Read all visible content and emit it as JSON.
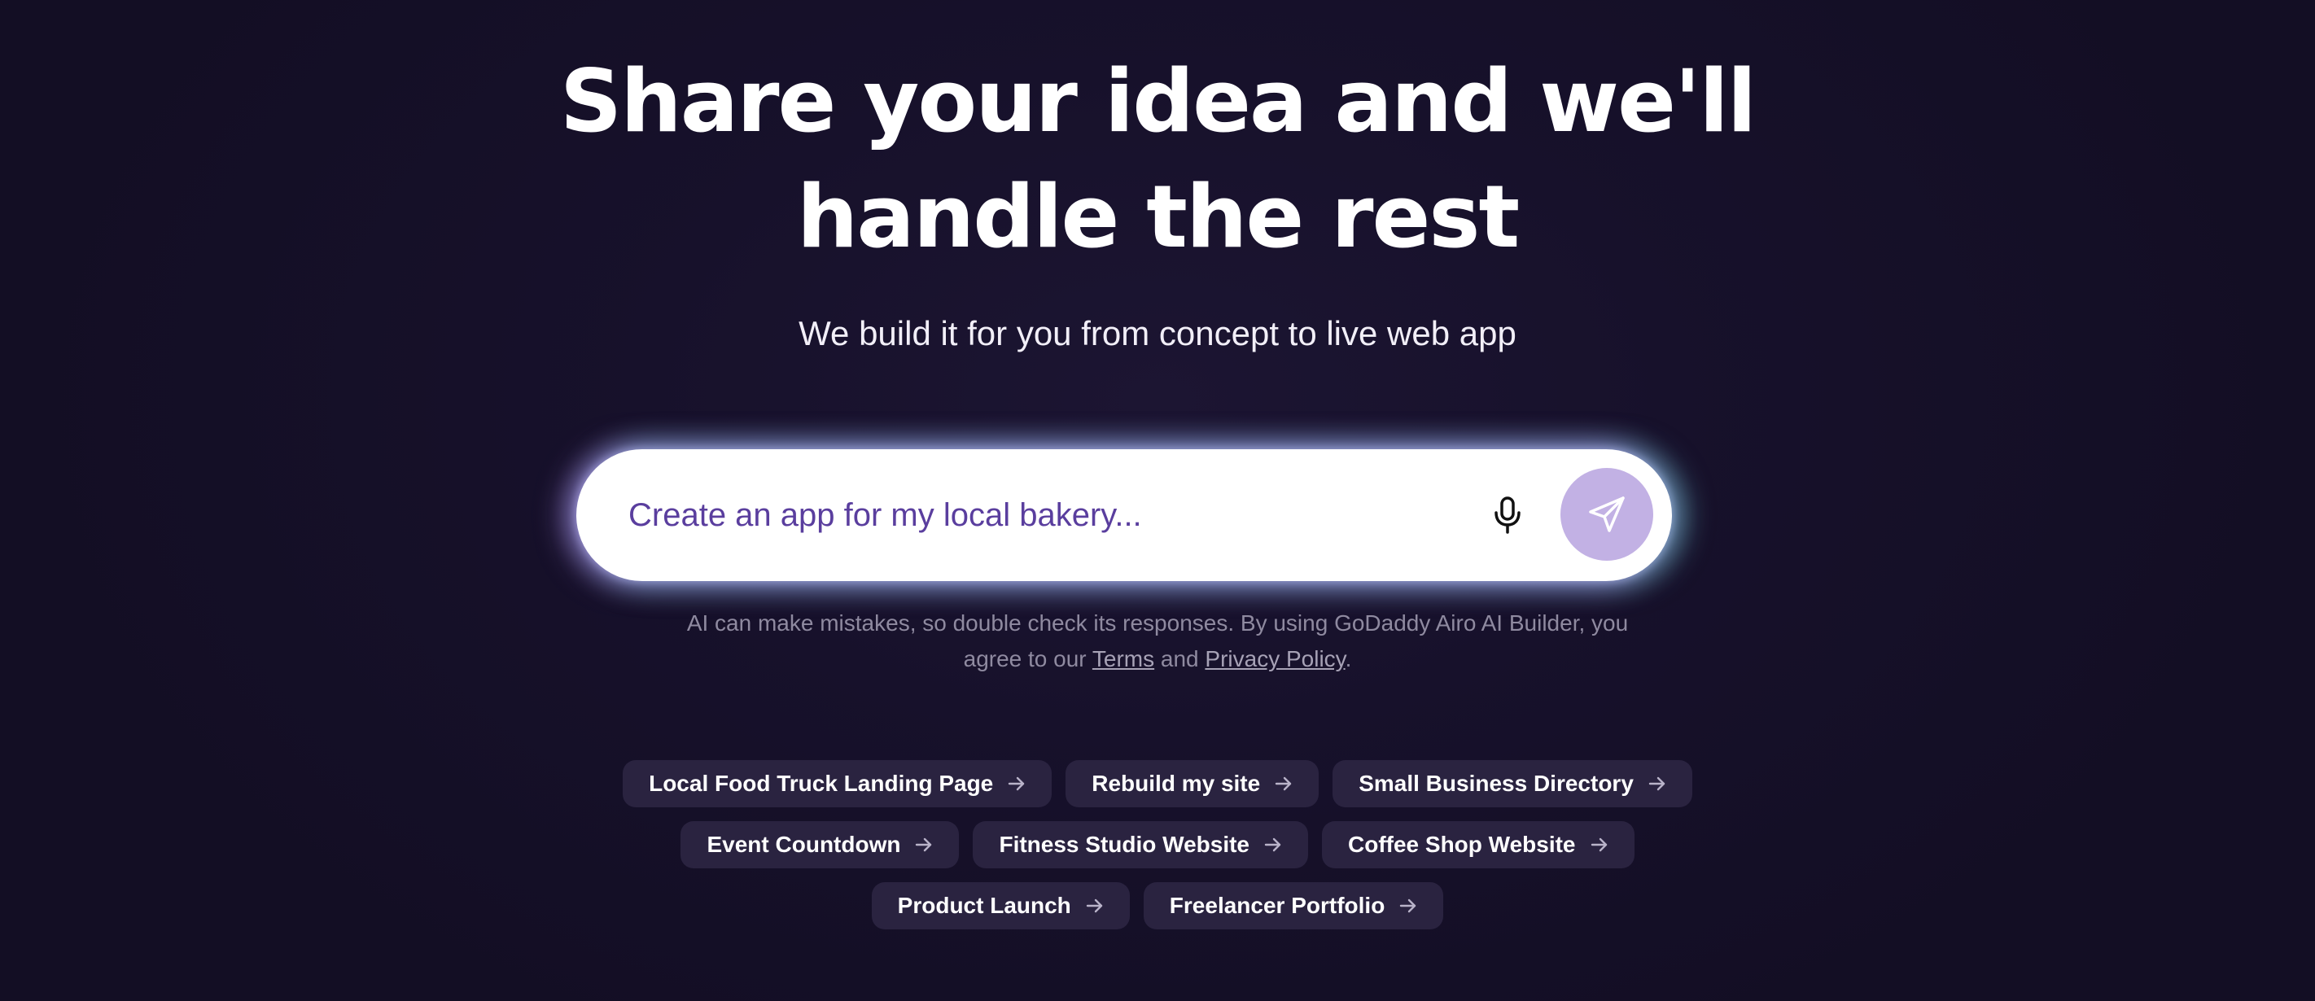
{
  "hero": {
    "headline_line1": "Share your idea and we'll",
    "headline_line2": "handle the rest",
    "subtitle": "We build it for you from concept to live web app"
  },
  "prompt": {
    "placeholder": "Create an app for my local bakery...",
    "value": "",
    "mic_icon": "microphone-icon",
    "send_icon": "send-icon"
  },
  "disclaimer": {
    "text_before": "AI can make mistakes, so double check its responses. By using GoDaddy Airo AI Builder, you agree to our ",
    "terms_label": "Terms",
    "and": " and ",
    "privacy_label": "Privacy Policy",
    "end": "."
  },
  "suggestions": {
    "row1": [
      "Local Food Truck Landing Page",
      "Rebuild my site",
      "Small Business Directory"
    ],
    "row2": [
      "Event Countdown",
      "Fitness Studio Website",
      "Coffee Shop Website"
    ],
    "row3": [
      "Product Launch",
      "Freelancer Portfolio"
    ],
    "arrow_icon": "arrow-right-icon"
  },
  "colors": {
    "background": "#17112b",
    "accent": "#5a3e9e",
    "send_button": "#c2b1e4",
    "chip": "#2a2340",
    "disclaimer_text": "#8f8aa0"
  }
}
